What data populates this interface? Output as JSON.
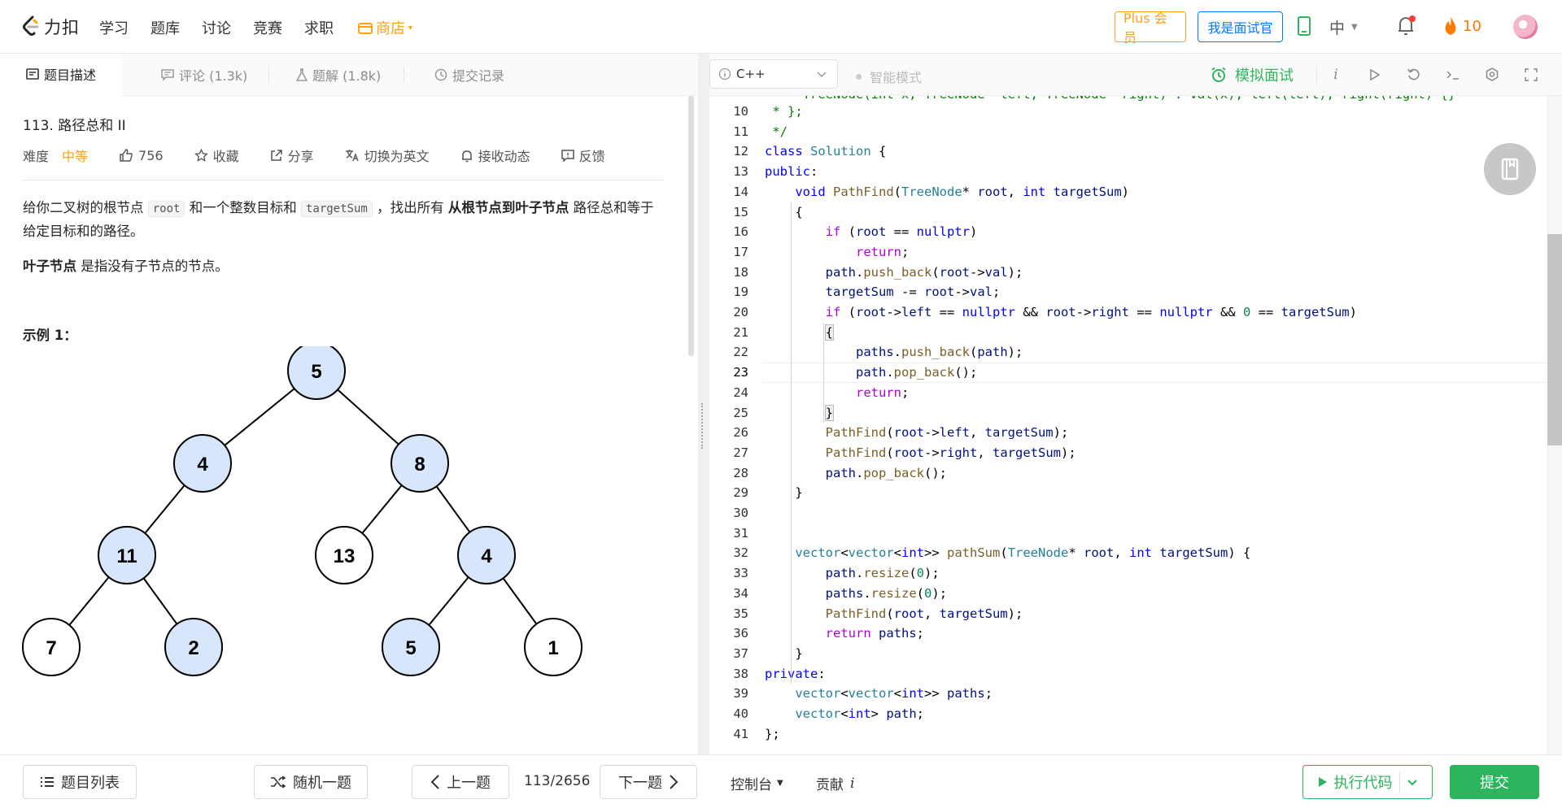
{
  "brand": "力扣",
  "nav": {
    "items": [
      "学习",
      "题库",
      "讨论",
      "竞赛",
      "求职"
    ],
    "shop": "商店",
    "plus": "Plus 会员",
    "interviewer": "我是面试官",
    "lang": "中",
    "streak": "10"
  },
  "left_tabs": [
    {
      "label": "题目描述"
    },
    {
      "label": "评论 (1.3k)"
    },
    {
      "label": "题解 (1.8k)"
    },
    {
      "label": "提交记录"
    }
  ],
  "problem": {
    "title": "113. 路径总和 II",
    "difficulty_label": "难度",
    "difficulty": "中等",
    "likes": "756",
    "favorite": "收藏",
    "share": "分享",
    "switch_lang": "切换为英文",
    "subscribe": "接收动态",
    "feedback": "反馈",
    "desc_1a": "给你二叉树的根节点 ",
    "desc_code1": "root",
    "desc_1b": " 和一个整数目标和 ",
    "desc_code2": "targetSum",
    "desc_1c": " ，找出所有 ",
    "desc_bold": "从根节点到叶子节点",
    "desc_1d": " 路径总和等于给定目标和的路径。",
    "desc_2_bold": "叶子节点",
    "desc_2": " 是指没有子节点的节点。",
    "example_heading": "示例 1："
  },
  "tree": {
    "nodes": [
      {
        "id": "n5",
        "label": "5",
        "highlight": true
      },
      {
        "id": "n4",
        "label": "4",
        "highlight": true
      },
      {
        "id": "n8",
        "label": "8",
        "highlight": true
      },
      {
        "id": "n11",
        "label": "11",
        "highlight": true
      },
      {
        "id": "n13",
        "label": "13",
        "highlight": false
      },
      {
        "id": "n4b",
        "label": "4",
        "highlight": true
      },
      {
        "id": "n7",
        "label": "7",
        "highlight": false
      },
      {
        "id": "n2",
        "label": "2",
        "highlight": true
      },
      {
        "id": "n5b",
        "label": "5",
        "highlight": true
      },
      {
        "id": "n1",
        "label": "1",
        "highlight": false
      }
    ],
    "highlight_color": "#d7e6fb"
  },
  "editor": {
    "language": "C++",
    "smart_mode": "智能模式",
    "mock_interview": "模拟面试",
    "current_line": 23,
    "lines": [
      {
        "n": "10",
        "html": "<span class=\"cm\"> * };</span>"
      },
      {
        "n": "11",
        "html": "<span class=\"cm\"> */</span>"
      },
      {
        "n": "12",
        "html": "<span class=\"kw\">class</span> <span class=\"ty\">Solution</span> {"
      },
      {
        "n": "13",
        "html": "<span class=\"kw\">public</span>:"
      },
      {
        "n": "14",
        "html": "    <span class=\"kw\">void</span> <span class=\"fn\">PathFind</span>(<span class=\"ty\">TreeNode</span>* <span class=\"vr\">root</span>, <span class=\"kw\">int</span> <span class=\"vr\">targetSum</span>)"
      },
      {
        "n": "15",
        "html": "    {"
      },
      {
        "n": "16",
        "html": "        <span class=\"pr\">if</span> (<span class=\"vr\">root</span> == <span class=\"kw\">nullptr</span>)"
      },
      {
        "n": "17",
        "html": "            <span class=\"pr\">return</span>;"
      },
      {
        "n": "18",
        "html": "        <span class=\"vr\">path</span>.<span class=\"fn\">push_back</span>(<span class=\"vr\">root</span>-&gt;<span class=\"vr\">val</span>);"
      },
      {
        "n": "19",
        "html": "        <span class=\"vr\">targetSum</span> -= <span class=\"vr\">root</span>-&gt;<span class=\"vr\">val</span>;"
      },
      {
        "n": "20",
        "html": "        <span class=\"pr\">if</span> (<span class=\"vr\">root</span>-&gt;<span class=\"vr\">left</span> == <span class=\"kw\">nullptr</span> &amp;&amp; <span class=\"vr\">root</span>-&gt;<span class=\"vr\">right</span> == <span class=\"kw\">nullptr</span> &amp;&amp; <span class=\"nm\">0</span> == <span class=\"vr\">targetSum</span>)"
      },
      {
        "n": "21",
        "html": "        <span class=\"bh\">{</span>"
      },
      {
        "n": "22",
        "html": "            <span class=\"vr\">paths</span>.<span class=\"fn\">push_back</span>(<span class=\"vr\">path</span>);"
      },
      {
        "n": "23",
        "html": "            <span class=\"vr\">path</span>.<span class=\"fn\">pop_back</span>();"
      },
      {
        "n": "24",
        "html": "            <span class=\"pr\">return</span>;"
      },
      {
        "n": "25",
        "html": "        <span class=\"bh\">}</span>"
      },
      {
        "n": "26",
        "html": "        <span class=\"fn\">PathFind</span>(<span class=\"vr\">root</span>-&gt;<span class=\"vr\">left</span>, <span class=\"vr\">targetSum</span>);"
      },
      {
        "n": "27",
        "html": "        <span class=\"fn\">PathFind</span>(<span class=\"vr\">root</span>-&gt;<span class=\"vr\">right</span>, <span class=\"vr\">targetSum</span>);"
      },
      {
        "n": "28",
        "html": "        <span class=\"vr\">path</span>.<span class=\"fn\">pop_back</span>();"
      },
      {
        "n": "29",
        "html": "    }"
      },
      {
        "n": "30",
        "html": ""
      },
      {
        "n": "31",
        "html": ""
      },
      {
        "n": "32",
        "html": "    <span class=\"ty\">vector</span>&lt;<span class=\"ty\">vector</span>&lt;<span class=\"kw\">int</span>&gt;&gt; <span class=\"fn\">pathSum</span>(<span class=\"ty\">TreeNode</span>* <span class=\"vr\">root</span>, <span class=\"kw\">int</span> <span class=\"vr\">targetSum</span>) {"
      },
      {
        "n": "33",
        "html": "        <span class=\"vr\">path</span>.<span class=\"fn\">resize</span>(<span class=\"nm\">0</span>);"
      },
      {
        "n": "34",
        "html": "        <span class=\"vr\">paths</span>.<span class=\"fn\">resize</span>(<span class=\"nm\">0</span>);"
      },
      {
        "n": "35",
        "html": "        <span class=\"fn\">PathFind</span>(<span class=\"vr\">root</span>, <span class=\"vr\">targetSum</span>);"
      },
      {
        "n": "36",
        "html": "        <span class=\"pr\">return</span> <span class=\"vr\">paths</span>;"
      },
      {
        "n": "37",
        "html": "    }"
      },
      {
        "n": "38",
        "html": "<span class=\"kw\">private</span>:"
      },
      {
        "n": "39",
        "html": "    <span class=\"ty\">vector</span>&lt;<span class=\"ty\">vector</span>&lt;<span class=\"kw\">int</span>&gt;&gt; <span class=\"vr\">paths</span>;"
      },
      {
        "n": "40",
        "html": "    <span class=\"ty\">vector</span>&lt;<span class=\"kw\">int</span>&gt; <span class=\"vr\">path</span>;"
      },
      {
        "n": "41",
        "html": "};"
      }
    ]
  },
  "bottom": {
    "problem_list": "题目列表",
    "random": "随机一题",
    "prev": "上一题",
    "page": "113/2656",
    "next": "下一题",
    "console": "控制台",
    "contribute": "贡献",
    "contribute_i": "i",
    "run": "执行代码",
    "submit": "提交"
  },
  "colors": {
    "accent": "#ffa116",
    "green": "#2db55d",
    "blue": "#007aff"
  }
}
